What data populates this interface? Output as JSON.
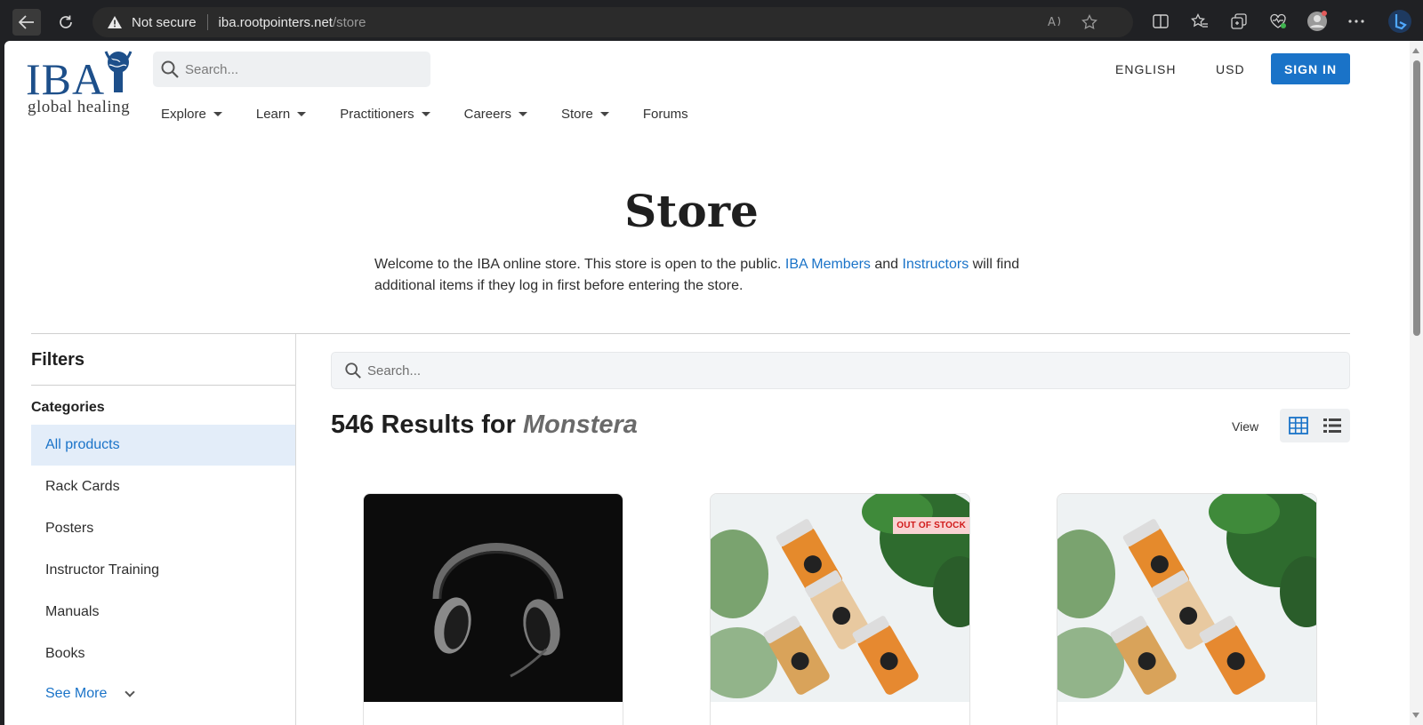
{
  "browser": {
    "security_text": "Not secure",
    "url_host": "iba.rootpointers.net",
    "url_path": "/store"
  },
  "site": {
    "logo_main": "IBA",
    "logo_sub": "global healing",
    "search_placeholder": "Search...",
    "language": "ENGLISH",
    "currency": "USD",
    "signin_label": "SIGN IN",
    "nav": [
      {
        "label": "Explore"
      },
      {
        "label": "Learn"
      },
      {
        "label": "Practitioners"
      },
      {
        "label": "Careers"
      },
      {
        "label": "Store"
      },
      {
        "label": "Forums"
      }
    ]
  },
  "hero": {
    "title": "Store",
    "desc_part1": "Welcome to the IBA online store. This store is open to the public.",
    "link_members": "IBA Members",
    "desc_and": "and",
    "link_instructors": "Instructors",
    "desc_part2": "will find additional items if they log in first before entering the store."
  },
  "filters": {
    "title": "Filters",
    "categories_title": "Categories",
    "categories": [
      {
        "label": "All products"
      },
      {
        "label": "Rack Cards"
      },
      {
        "label": "Posters"
      },
      {
        "label": "Instructor Training"
      },
      {
        "label": "Manuals"
      },
      {
        "label": "Books"
      }
    ],
    "see_more": "See More"
  },
  "results": {
    "search_placeholder": "Search...",
    "count_text": "546 Results for",
    "term": "Monstera",
    "view_label": "View",
    "badge_out_of_stock": "OUT OF STOCK"
  },
  "colors": {
    "brand_blue": "#1a73c8",
    "logo_blue": "#1d4f8a"
  }
}
